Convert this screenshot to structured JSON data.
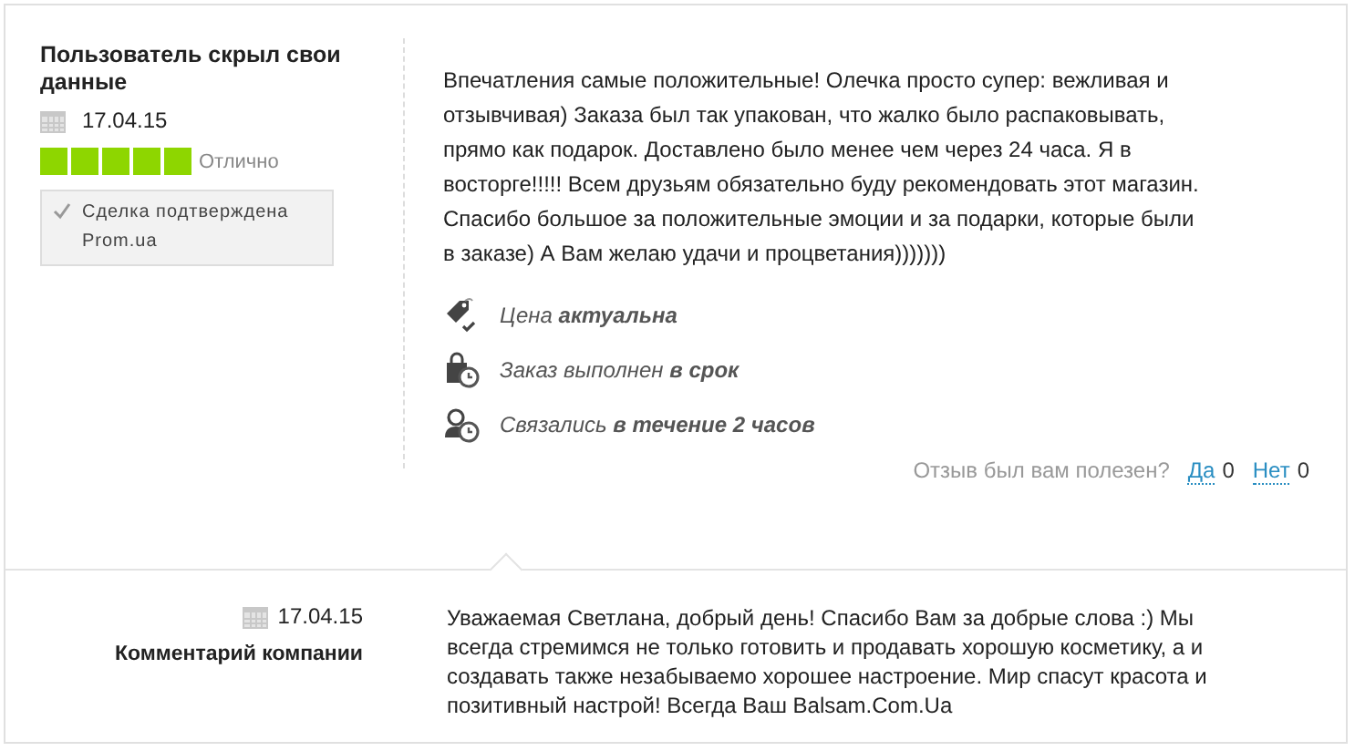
{
  "review": {
    "author": "Пользователь скрыл свои данные",
    "date": "17.04.15",
    "stars": 5,
    "rating_label": "Отлично",
    "verified": {
      "checked": true,
      "label": "Сделка подтверждена Prom.ua"
    },
    "text": "Впечатления самые положительные! Олечка просто супер: вежливая и отзывчивая) Заказа был так упакован, что жалко было распаковывать, прямо как подарок. Доставлено было менее чем через 24 часа. Я в восторге!!!!! Всем друзьям обязательно буду рекомендовать этот магазин. Спасибо большое за положительные эмоции и за подарки, которые были в заказе) А Вам желаю удачи и процветания)))))))",
    "features": [
      {
        "kind": "price",
        "text": "Цена **актуальна**"
      },
      {
        "kind": "order",
        "text": "Заказ выполнен **в срок**"
      },
      {
        "kind": "contact",
        "text": "Связались **в течение 2 часов**"
      }
    ],
    "helpful": {
      "question": "Отзыв был вам полезен?",
      "yes": "Да",
      "yes_count": "0",
      "no": "Нет",
      "no_count": "0"
    }
  },
  "company_reply": {
    "date": "17.04.15",
    "label": "Комментарий компании",
    "text": "Уважаемая Светлана, добрый день! Спасибо Вам за добрые слова :) Мы всегда стремимся не только готовить и продавать хорошую косметику, а и создавать также незабываемо хорошее настроение. Мир спасут красота и позитивный настрой! Всегда Ваш Balsam.Com.Ua"
  }
}
